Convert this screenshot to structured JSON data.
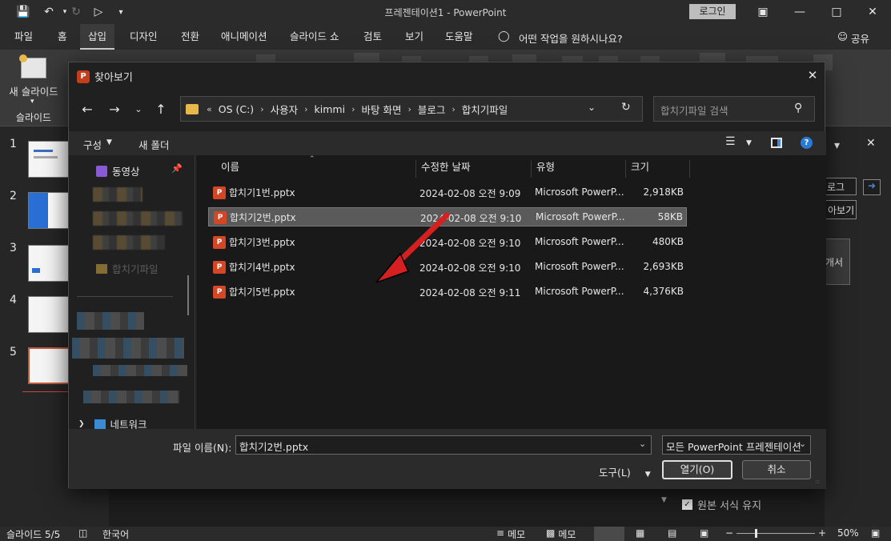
{
  "app": {
    "title": "프레젠테이션1  -  PowerPoint",
    "login": "로그인"
  },
  "menu": {
    "tabs": [
      "파일",
      "홈",
      "삽입",
      "디자인",
      "전환",
      "애니메이션",
      "슬라이드 쇼",
      "검토",
      "보기",
      "도움말"
    ],
    "active_index": 2,
    "tell_me": "어떤 작업을 원하시나요?",
    "share": "공유"
  },
  "ribbon": {
    "new_slide": "새 슬라이드",
    "slides_group": "슬라이드"
  },
  "thumbnails": [
    "1",
    "2",
    "3",
    "4",
    "5"
  ],
  "right_pane": {
    "partial_dropdown": "로그",
    "partial_button": "아보기",
    "partial_text": "개서",
    "keep_format": "원본 서식 유지"
  },
  "status": {
    "slide": "슬라이드 5/5",
    "language": "한국어",
    "notes1": "메모",
    "notes2": "메모",
    "zoom": "50%"
  },
  "dialog": {
    "title": "찾아보기",
    "breadcrumb": [
      "OS (C:)",
      "사용자",
      "kimmi",
      "바탕 화면",
      "블로그",
      "합치기파일"
    ],
    "search_placeholder": "합치기파일 검색",
    "organize": "구성",
    "new_folder": "새 폴더",
    "nav": {
      "videos": "동영상",
      "partial_folder": "합치기파일",
      "network": "네트워크"
    },
    "columns": [
      "이름",
      "수정한 날짜",
      "유형",
      "크기"
    ],
    "files": [
      {
        "name": "합치기1번.pptx",
        "date": "2024-02-08 오전 9:09",
        "type": "Microsoft PowerP...",
        "size": "2,918KB"
      },
      {
        "name": "합치기2번.pptx",
        "date": "2024-02-08 오전 9:10",
        "type": "Microsoft PowerP...",
        "size": "58KB"
      },
      {
        "name": "합치기3번.pptx",
        "date": "2024-02-08 오전 9:10",
        "type": "Microsoft PowerP...",
        "size": "480KB"
      },
      {
        "name": "합치기4번.pptx",
        "date": "2024-02-08 오전 9:10",
        "type": "Microsoft PowerP...",
        "size": "2,693KB"
      },
      {
        "name": "합치기5번.pptx",
        "date": "2024-02-08 오전 9:11",
        "type": "Microsoft PowerP...",
        "size": "4,376KB"
      }
    ],
    "selected_index": 1,
    "filename_label": "파일 이름(N):",
    "filename_value": "합치기2번.pptx",
    "filter": "모든 PowerPoint 프레젠테이션",
    "tools": "도구(L)",
    "open": "열기(O)",
    "cancel": "취소"
  },
  "colors": {
    "accent_red": "#d42020",
    "ppt_orange": "#d24726",
    "selected_row": "#5a5a5a"
  }
}
